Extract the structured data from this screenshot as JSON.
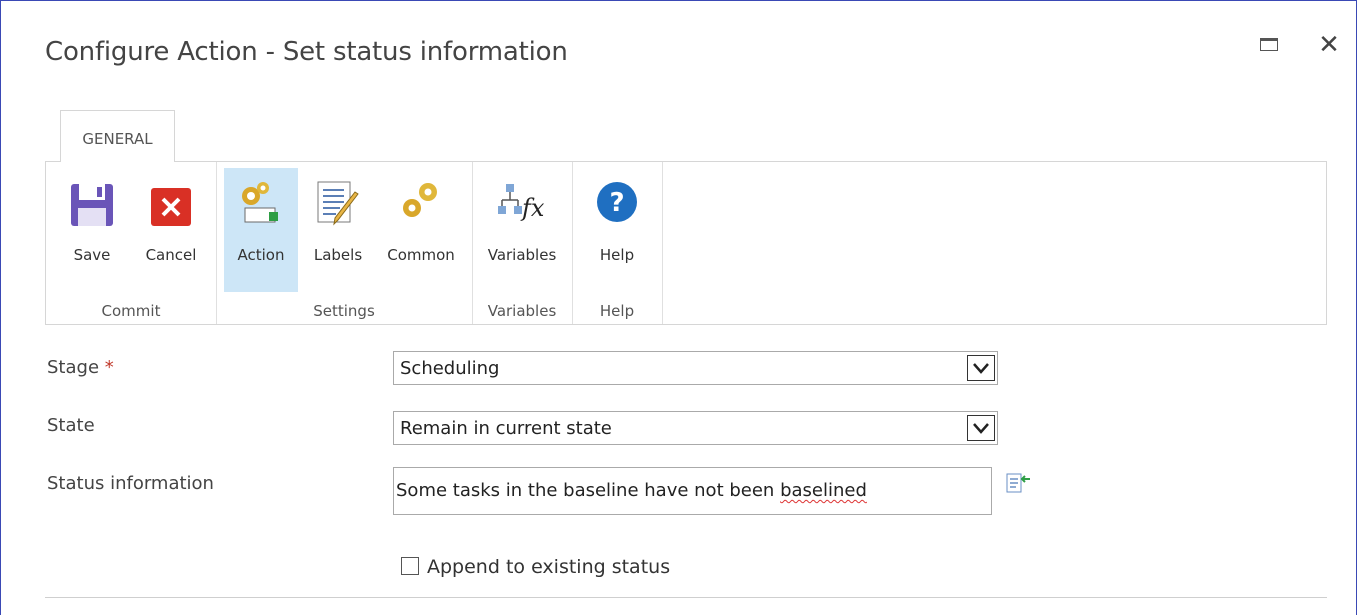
{
  "dialog": {
    "title": "Configure Action - Set status information"
  },
  "ribbon": {
    "tab": "GENERAL",
    "groups": [
      {
        "label": "Commit",
        "buttons": [
          {
            "label": "Save",
            "icon": "save-icon"
          },
          {
            "label": "Cancel",
            "icon": "cancel-icon"
          }
        ]
      },
      {
        "label": "Settings",
        "buttons": [
          {
            "label": "Action",
            "icon": "action-icon",
            "selected": true
          },
          {
            "label": "Labels",
            "icon": "labels-icon"
          },
          {
            "label": "Common",
            "icon": "common-gears-icon"
          }
        ]
      },
      {
        "label": "Variables",
        "buttons": [
          {
            "label": "Variables",
            "icon": "variables-fx-icon"
          }
        ]
      },
      {
        "label": "Help",
        "buttons": [
          {
            "label": "Help",
            "icon": "help-icon"
          }
        ]
      }
    ]
  },
  "form": {
    "stage": {
      "label": "Stage",
      "required_mark": "*",
      "value": "Scheduling"
    },
    "state": {
      "label": "State",
      "value": "Remain in current state"
    },
    "status_information": {
      "label": "Status information",
      "value_prefix": "Some tasks in the baseline have not been ",
      "value_misspelled": "baselined"
    },
    "append": {
      "label": "Append to existing status",
      "checked": false
    }
  },
  "colors": {
    "accent_selected": "#cde6f7",
    "border": "#3a49b5",
    "required": "#c0392b"
  }
}
